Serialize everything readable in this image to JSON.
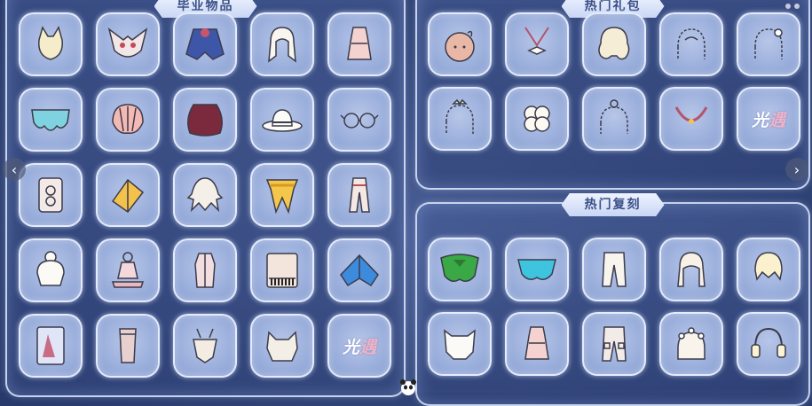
{
  "panels": {
    "left": {
      "title": "毕业物品"
    },
    "right_top": {
      "title": "热门礼包"
    },
    "right_bottom": {
      "title": "热门复刻"
    }
  },
  "left_items": [
    "cat-ears-hair-icon",
    "winged-mask-icon",
    "blue-cape-icon",
    "white-hair-icon",
    "pink-outfit-icon",
    "cloud-cape-icon",
    "shell-cape-icon",
    "dark-red-cape-icon",
    "white-hat-icon",
    "glasses-icon",
    "rune-banner-icon",
    "golden-lantern-icon",
    "messy-hair-icon",
    "golden-ribbon-cape-icon",
    "white-pants-outfit-icon",
    "updo-hair-icon",
    "stage-outfit-icon",
    "robe-outfit-icon",
    "piano-icon",
    "blue-wing-cape-icon",
    "card-portrait-icon",
    "stone-pillar-icon",
    "antler-mask-icon",
    "horned-hair-icon",
    "sky-logo-icon"
  ],
  "right_top_items": [
    "bun-head-icon",
    "bow-necklace-icon",
    "curly-hair-icon",
    "dotted-hair-outline-icon",
    "flower-hair-outline-icon",
    "crown-hair-outline-icon",
    "clover-icon",
    "bun-hair-outline-icon",
    "lantern-necklace-icon",
    "sky-logo-icon"
  ],
  "right_bottom_items": [
    "green-cape-icon",
    "teal-cape-icon",
    "white-pants-icon",
    "braided-hair-icon",
    "short-hair-icon",
    "white-hood-icon",
    "pink-outfit-icon",
    "cargo-pants-icon",
    "flower-crown-icon",
    "headphones-icon"
  ],
  "logo_text": {
    "main": "光",
    "accent": "遇"
  },
  "colors": {
    "background": "#33477a",
    "panel_border": "#e1ebff",
    "slot_fill": "#9bafdc",
    "title_text": "#3a4f86"
  }
}
